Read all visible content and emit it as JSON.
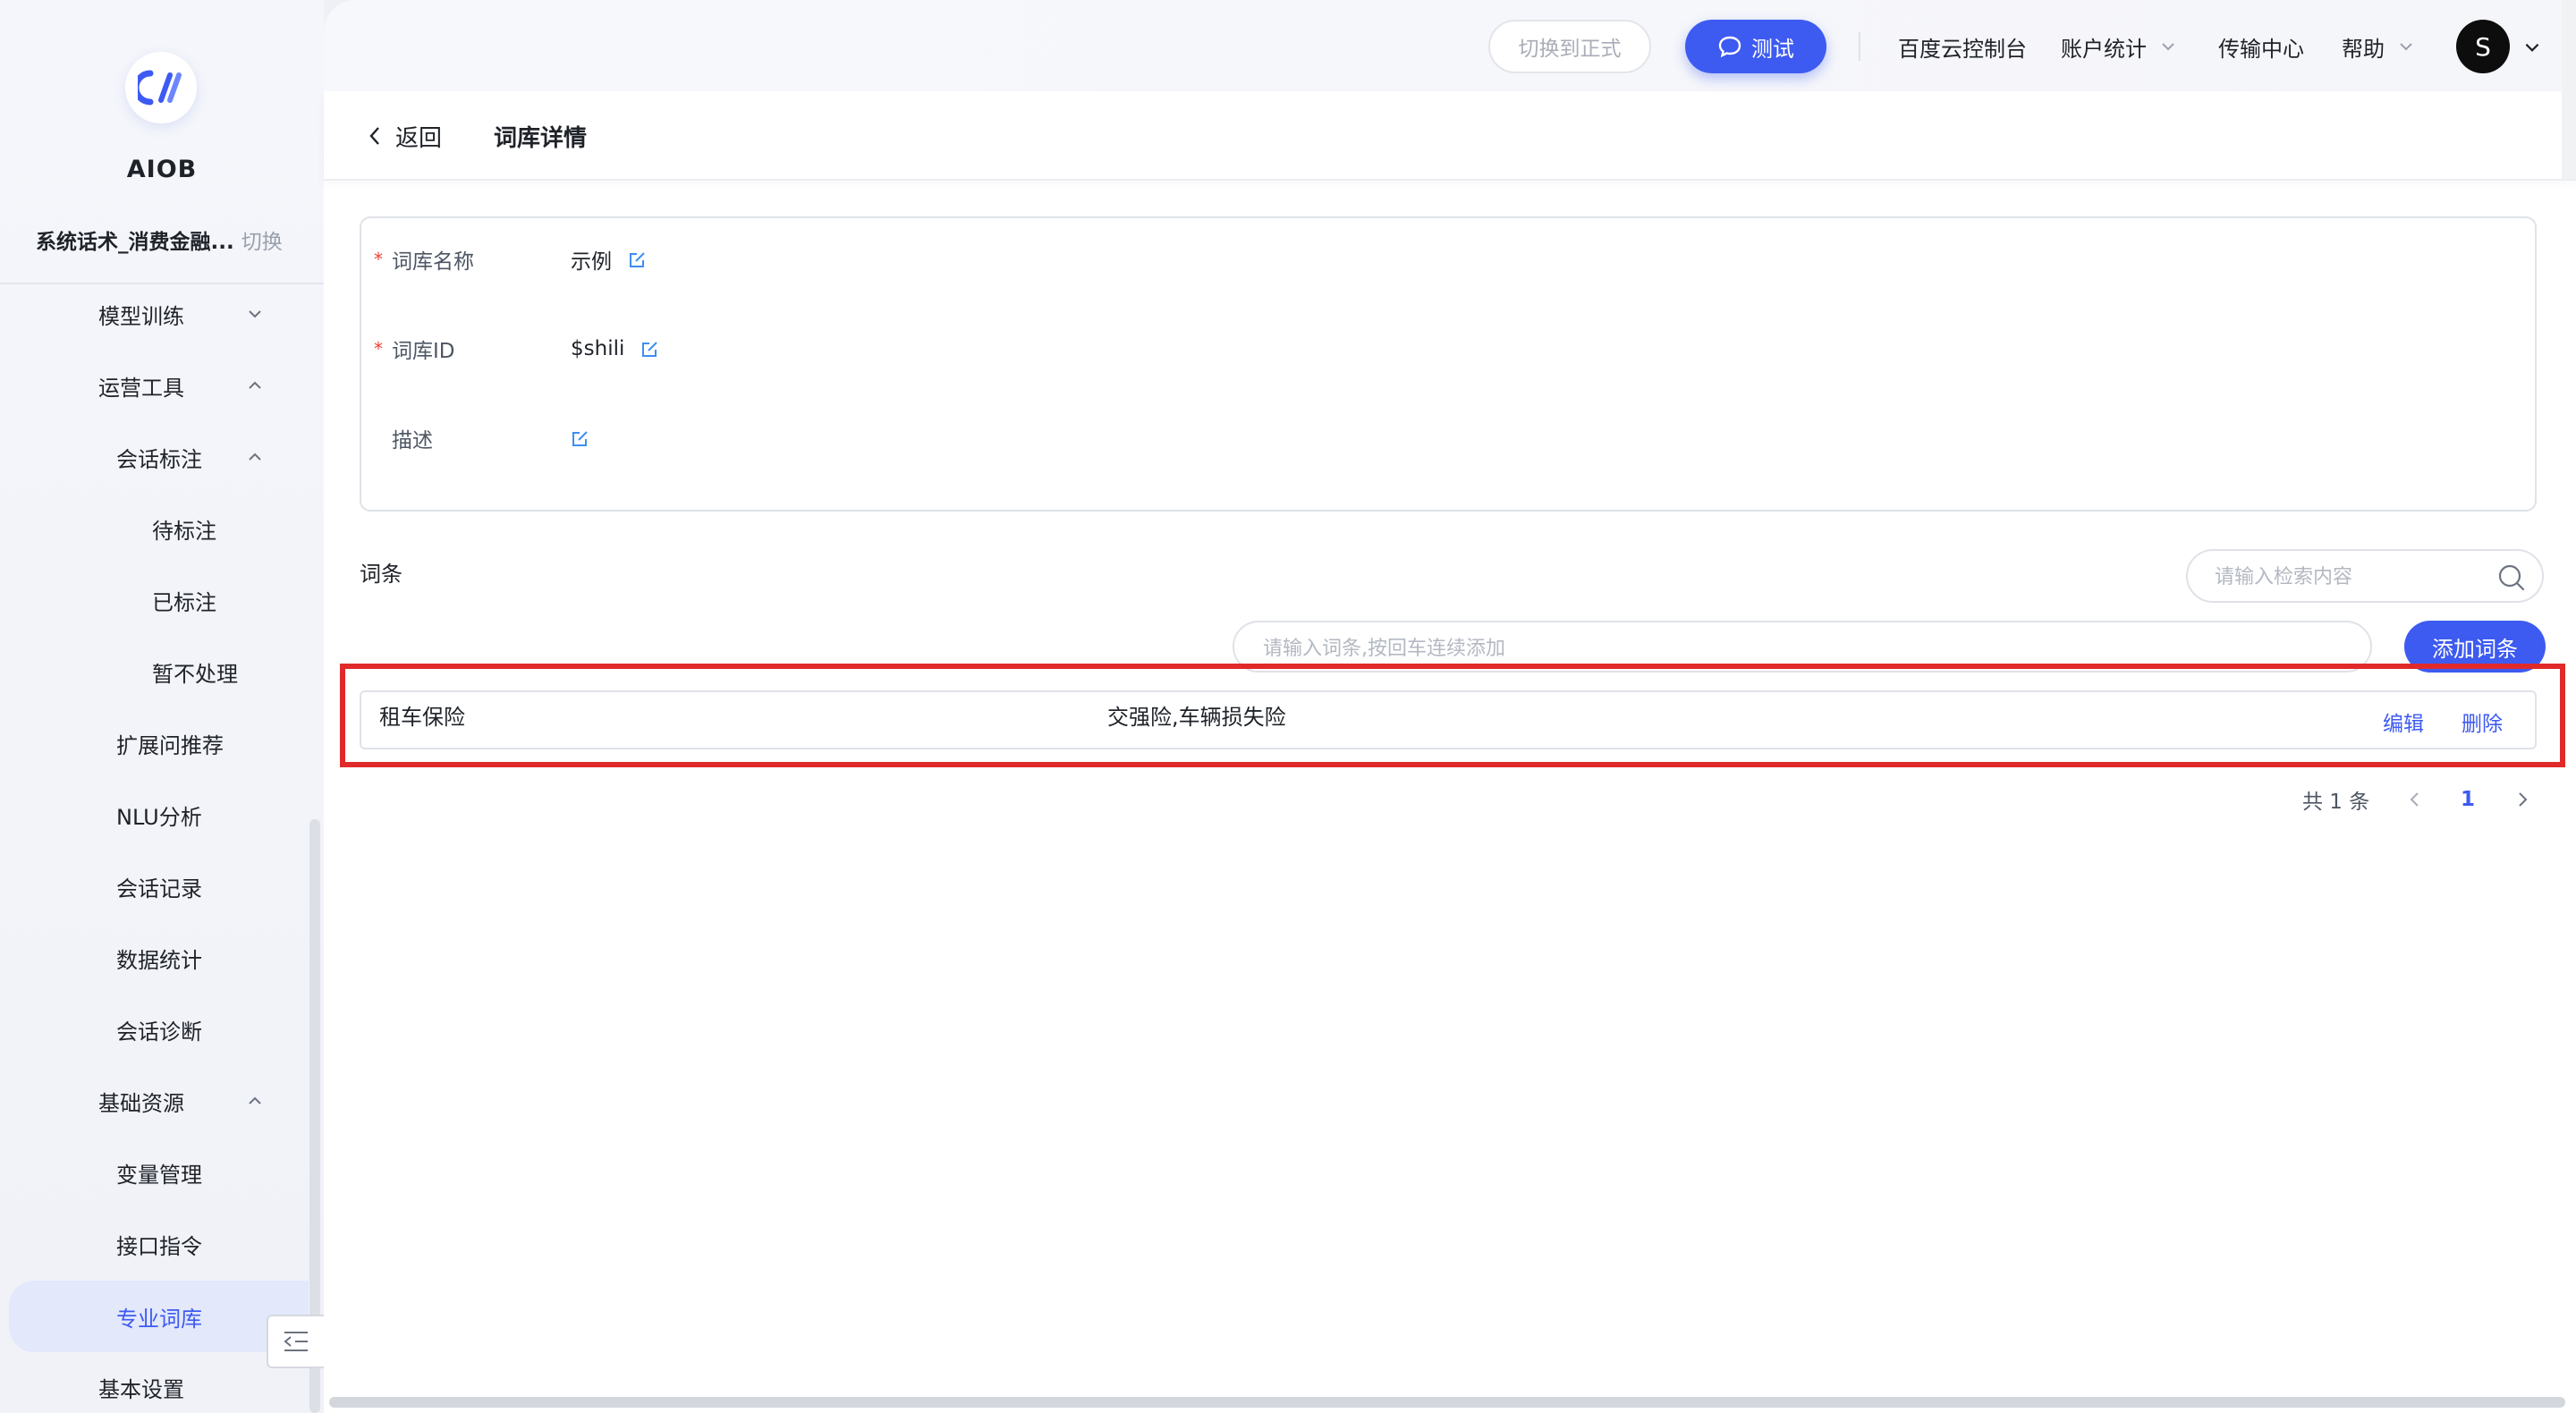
{
  "sidebar": {
    "brand": "AIOB",
    "workspace_name": "系统话术_消费金融...",
    "workspace_switch": "切换",
    "items": [
      {
        "label": "模型训练",
        "chevron": "down"
      },
      {
        "label": "运营工具",
        "chevron": "up"
      },
      {
        "label": "会话标注",
        "chevron": "up"
      },
      {
        "label": "待标注"
      },
      {
        "label": "已标注"
      },
      {
        "label": "暂不处理"
      },
      {
        "label": "扩展问推荐"
      },
      {
        "label": "NLU分析"
      },
      {
        "label": "会话记录"
      },
      {
        "label": "数据统计"
      },
      {
        "label": "会话诊断"
      },
      {
        "label": "基础资源",
        "chevron": "up"
      },
      {
        "label": "变量管理"
      },
      {
        "label": "接口指令"
      },
      {
        "label": "专业词库",
        "active": true
      },
      {
        "label": "基本设置"
      }
    ]
  },
  "topbar": {
    "switch_label": "切换到正式",
    "test_label": "测试",
    "links": [
      "百度云控制台",
      "账户统计",
      "传输中心",
      "帮助"
    ],
    "avatar": "S"
  },
  "header": {
    "back_label": "返回",
    "title": "词库详情"
  },
  "info": {
    "name_label": "词库名称",
    "name_value": "示例",
    "id_label": "词库ID",
    "id_value": "$shili",
    "desc_label": "描述",
    "desc_value": ""
  },
  "entries": {
    "section_label": "词条",
    "search_placeholder": "请输入检索内容",
    "add_placeholder": "请输入词条,按回车连续添加",
    "add_button": "添加词条",
    "rows": [
      {
        "word": "租车保险",
        "synonyms": "交强险,车辆损失险",
        "edit": "编辑",
        "delete": "删除"
      }
    ]
  },
  "pagination": {
    "total": "共 1 条",
    "current": "1"
  },
  "colors": {
    "accent": "#3d5af1",
    "highlight": "#e02a2a",
    "required": "#f04134"
  }
}
